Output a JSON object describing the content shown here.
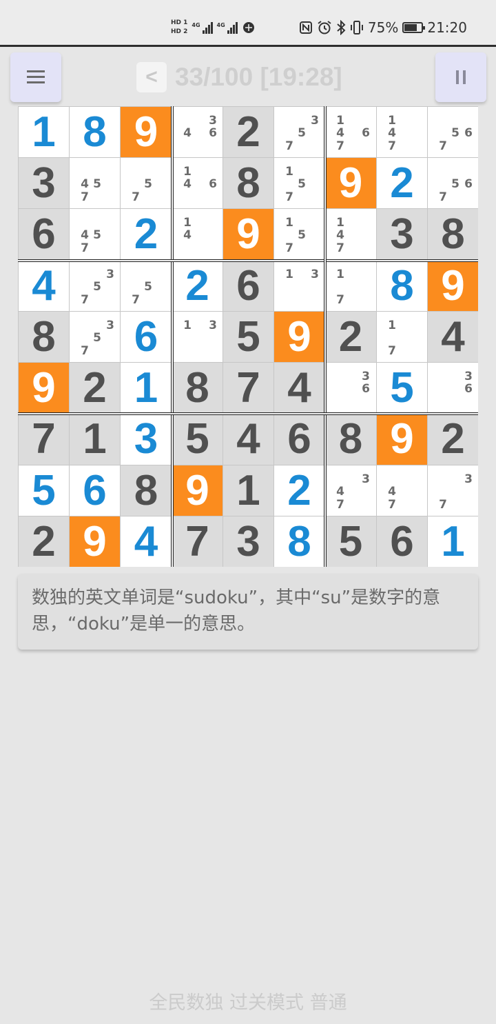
{
  "status_bar": {
    "sim1": "HD 1",
    "sim2": "HD 2",
    "network1": "4G",
    "network2": "4G",
    "battery_percent": "75%",
    "battery_level": 0.75,
    "time": "21:20",
    "icons": [
      "hd-sim-icon",
      "signal-icon",
      "signal-icon",
      "data-saver-icon",
      "nfc-icon",
      "alarm-icon",
      "bluetooth-icon",
      "vibrate-icon",
      "battery-icon"
    ]
  },
  "header": {
    "menu_icon": "menu-icon",
    "back_label": "<",
    "level_progress": "33/100 [19:28]",
    "pause_icon": "pause-icon"
  },
  "board": {
    "highlight_digit": 9,
    "colors": {
      "given": "#505050",
      "entered": "#1a8ad4",
      "highlight": "#fb8c1e",
      "note": "#6b6b6b"
    },
    "cells": [
      [
        {
          "v": "1",
          "t": "entered"
        },
        {
          "v": "8",
          "t": "entered"
        },
        {
          "v": "9",
          "t": "given"
        },
        {
          "notes": [
            3,
            4,
            6
          ]
        },
        {
          "v": "2",
          "t": "given"
        },
        {
          "notes": [
            3,
            5,
            7
          ]
        },
        {
          "notes": [
            1,
            4,
            6,
            7
          ]
        },
        {
          "notes": [
            1,
            4,
            7
          ]
        },
        {
          "notes": [
            5,
            6,
            7
          ]
        }
      ],
      [
        {
          "v": "3",
          "t": "given"
        },
        {
          "notes": [
            4,
            5,
            7
          ]
        },
        {
          "notes": [
            5,
            7
          ]
        },
        {
          "notes": [
            1,
            4,
            6
          ]
        },
        {
          "v": "8",
          "t": "given"
        },
        {
          "notes": [
            1,
            5,
            7
          ]
        },
        {
          "v": "9",
          "t": "given"
        },
        {
          "v": "2",
          "t": "entered"
        },
        {
          "notes": [
            5,
            6,
            7
          ]
        }
      ],
      [
        {
          "v": "6",
          "t": "given"
        },
        {
          "notes": [
            4,
            5,
            7
          ]
        },
        {
          "v": "2",
          "t": "entered"
        },
        {
          "notes": [
            1,
            4
          ]
        },
        {
          "v": "9",
          "t": "given"
        },
        {
          "notes": [
            1,
            5,
            7
          ]
        },
        {
          "notes": [
            1,
            4,
            7
          ]
        },
        {
          "v": "3",
          "t": "given"
        },
        {
          "v": "8",
          "t": "given"
        }
      ],
      [
        {
          "v": "4",
          "t": "entered"
        },
        {
          "notes": [
            3,
            5,
            7
          ]
        },
        {
          "notes": [
            5,
            7
          ]
        },
        {
          "v": "2",
          "t": "entered"
        },
        {
          "v": "6",
          "t": "given"
        },
        {
          "notes": [
            1,
            3
          ]
        },
        {
          "notes": [
            1,
            7
          ]
        },
        {
          "v": "8",
          "t": "entered"
        },
        {
          "v": "9",
          "t": "given"
        }
      ],
      [
        {
          "v": "8",
          "t": "given"
        },
        {
          "notes": [
            3,
            5,
            7
          ]
        },
        {
          "v": "6",
          "t": "entered"
        },
        {
          "notes": [
            1,
            3
          ]
        },
        {
          "v": "5",
          "t": "given"
        },
        {
          "v": "9",
          "t": "given"
        },
        {
          "v": "2",
          "t": "given"
        },
        {
          "notes": [
            1,
            7
          ]
        },
        {
          "v": "4",
          "t": "given"
        }
      ],
      [
        {
          "v": "9",
          "t": "given"
        },
        {
          "v": "2",
          "t": "given"
        },
        {
          "v": "1",
          "t": "entered"
        },
        {
          "v": "8",
          "t": "given"
        },
        {
          "v": "7",
          "t": "given"
        },
        {
          "v": "4",
          "t": "given"
        },
        {
          "notes": [
            3,
            6
          ]
        },
        {
          "v": "5",
          "t": "entered"
        },
        {
          "notes": [
            3,
            6
          ]
        }
      ],
      [
        {
          "v": "7",
          "t": "given"
        },
        {
          "v": "1",
          "t": "given"
        },
        {
          "v": "3",
          "t": "entered"
        },
        {
          "v": "5",
          "t": "given"
        },
        {
          "v": "4",
          "t": "given"
        },
        {
          "v": "6",
          "t": "given"
        },
        {
          "v": "8",
          "t": "given"
        },
        {
          "v": "9",
          "t": "given"
        },
        {
          "v": "2",
          "t": "given"
        }
      ],
      [
        {
          "v": "5",
          "t": "entered"
        },
        {
          "v": "6",
          "t": "entered"
        },
        {
          "v": "8",
          "t": "given"
        },
        {
          "v": "9",
          "t": "given"
        },
        {
          "v": "1",
          "t": "given"
        },
        {
          "v": "2",
          "t": "entered"
        },
        {
          "notes": [
            3,
            4,
            7
          ]
        },
        {
          "notes": [
            4,
            7
          ]
        },
        {
          "notes": [
            3,
            7
          ]
        }
      ],
      [
        {
          "v": "2",
          "t": "given"
        },
        {
          "v": "9",
          "t": "given"
        },
        {
          "v": "4",
          "t": "entered"
        },
        {
          "v": "7",
          "t": "given"
        },
        {
          "v": "3",
          "t": "given"
        },
        {
          "v": "8",
          "t": "entered"
        },
        {
          "v": "5",
          "t": "given"
        },
        {
          "v": "6",
          "t": "given"
        },
        {
          "v": "1",
          "t": "entered"
        }
      ]
    ]
  },
  "tip": {
    "text": "数独的英文单词是“sudoku”，其中“su”是数字的意思，“doku”是单一的意思。"
  },
  "footer": {
    "text": "全民数独 过关模式 普通"
  }
}
